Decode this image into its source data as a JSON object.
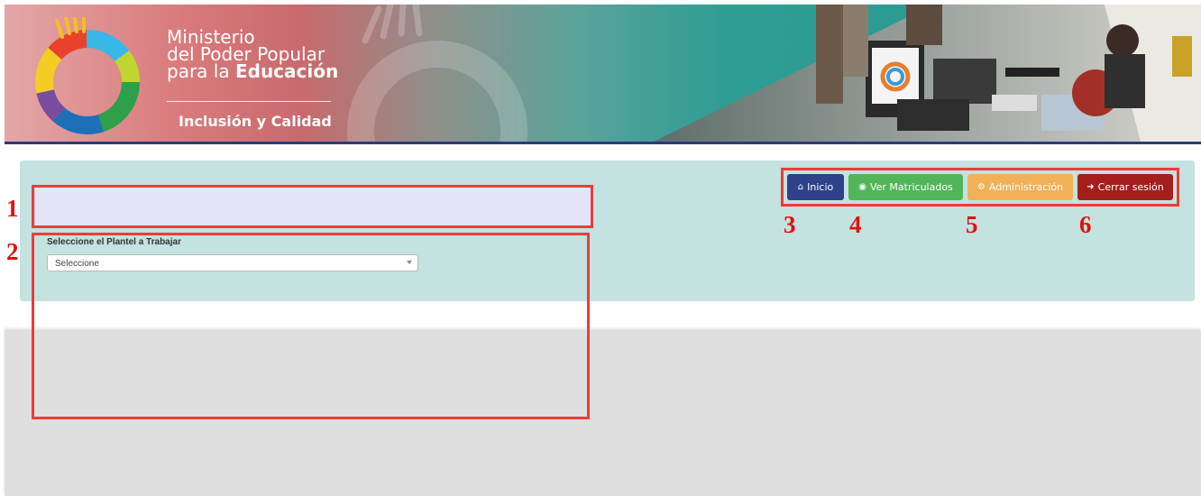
{
  "header": {
    "ministry_line1": "Ministerio",
    "ministry_line2": "del Poder Popular",
    "ministry_line3_prefix": "para la ",
    "ministry_line3_bold": "Educación",
    "subtitle": "Inclusión y Calidad"
  },
  "nav": {
    "inicio": {
      "label": "Inicio",
      "icon": "home-icon",
      "color": "#2e4189"
    },
    "ver_matriculados": {
      "label": "Ver Matriculados",
      "icon": "eye-icon",
      "color": "#52b559"
    },
    "administracion": {
      "label": "Administración",
      "icon": "gears-icon",
      "color": "#f1b159"
    },
    "cerrar_sesion": {
      "label": "Cerrar sesión",
      "icon": "sign-out-icon",
      "color": "#a41e1c"
    }
  },
  "form": {
    "plantel_label": "Seleccione el Plantel a Trabajar",
    "plantel_selected": "Seleccione"
  },
  "annotations": {
    "n1": "1",
    "n2": "2",
    "n3": "3",
    "n4": "4",
    "n5": "5",
    "n6": "6"
  },
  "colors": {
    "panel": "#c4e2df",
    "annotation": "#ee3b3b",
    "banner_rule": "#2b3b7c"
  }
}
